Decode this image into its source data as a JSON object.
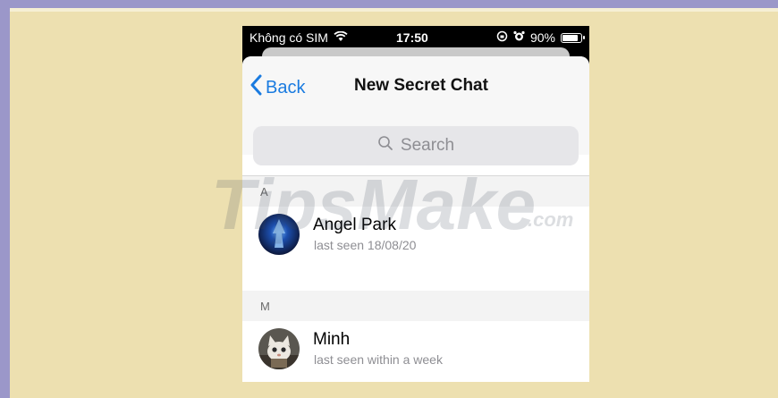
{
  "status_bar": {
    "carrier": "Không có SIM",
    "time": "17:50",
    "battery": "90%",
    "battery_level": 0.9,
    "icons": [
      "wifi-icon",
      "lock-rotation-icon",
      "alarm-icon",
      "battery-icon"
    ]
  },
  "nav": {
    "back_label": "Back",
    "title": "New Secret Chat"
  },
  "search": {
    "placeholder": "Search"
  },
  "sections": [
    {
      "header": "A",
      "contacts": [
        {
          "name": "Angel Park",
          "status": "last seen 18/08/20"
        }
      ]
    },
    {
      "header": "M",
      "contacts": [
        {
          "name": "Minh",
          "status": "last seen within a week"
        }
      ]
    }
  ],
  "watermark": {
    "text": "TipsMake",
    "suffix": ".com"
  },
  "colors": {
    "accent": "#1a7be0",
    "background": "#ede0b0",
    "frame": "#9b97c9"
  }
}
